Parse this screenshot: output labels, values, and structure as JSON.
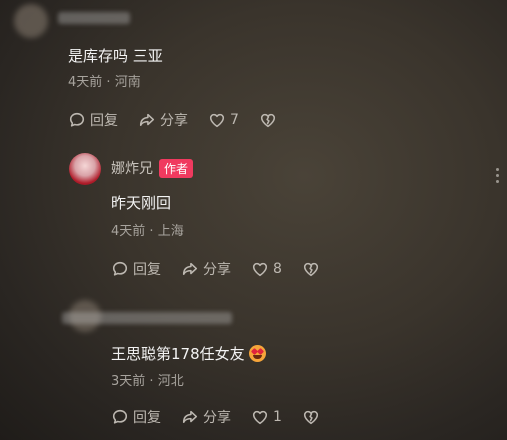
{
  "comments": [
    {
      "text": "是库存吗 三亚",
      "time": "4天前",
      "location": "河南",
      "reply_label": "回复",
      "share_label": "分享",
      "likes": "7"
    },
    {
      "author": "娜炸兄",
      "badge": "作者",
      "text": "昨天刚回",
      "time": "4天前",
      "location": "上海",
      "reply_label": "回复",
      "share_label": "分享",
      "likes": "8"
    },
    {
      "text": "王思聪第178任女友",
      "time": "3天前",
      "location": "河北",
      "reply_label": "回复",
      "share_label": "分享",
      "likes": "1"
    }
  ],
  "separator": "·",
  "icons": [
    "comment-icon",
    "share-icon",
    "heart-icon",
    "broken-heart-icon",
    "more-icon",
    "star-struck-emoji"
  ]
}
